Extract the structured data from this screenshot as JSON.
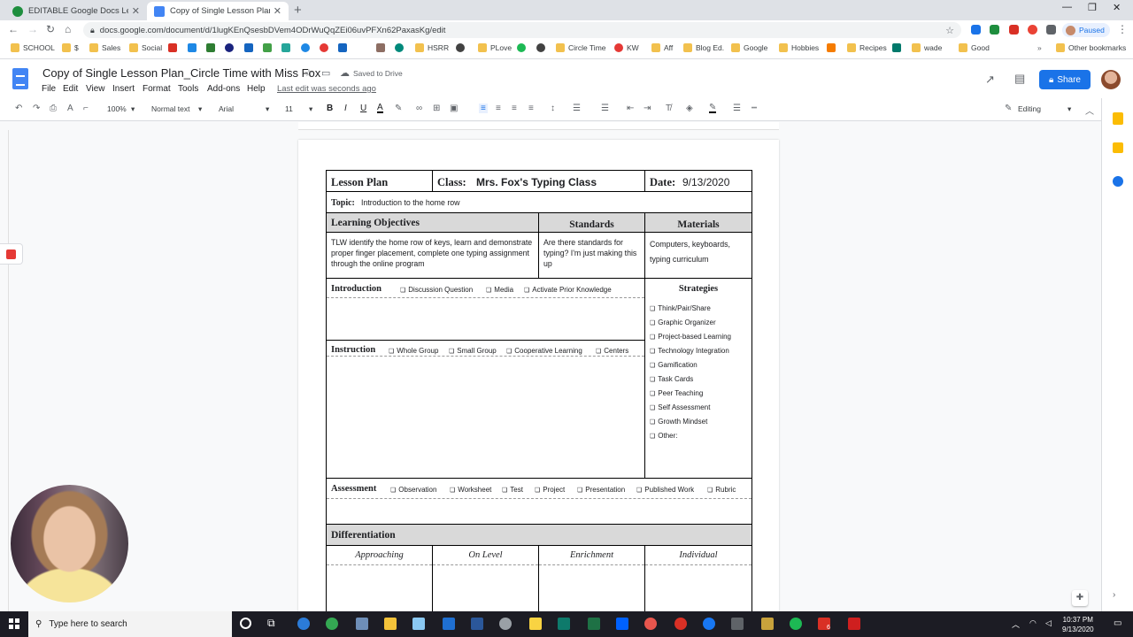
{
  "browser": {
    "tabs": [
      {
        "title": "EDITABLE Google Docs Lesson Pl",
        "icon": "edge-icon",
        "color": "#1e8e3e",
        "active": false
      },
      {
        "title": "Copy of Single Lesson Plan_Circle",
        "icon": "docs-icon",
        "color": "#4285f4",
        "active": true
      }
    ],
    "url": "docs.google.com/document/d/1lugKEnQsesbDVem4ODrWuQqZEi06uvPFXn62PaxasKg/edit",
    "profile_label": "Paused",
    "bookmarks": [
      "SCHOOL",
      "$",
      "Sales",
      "Social",
      "",
      "",
      "",
      "",
      "",
      "",
      "",
      "",
      "",
      "",
      "HSRR",
      "",
      "PLove",
      "",
      "Circle Time",
      "KW",
      "Aff",
      "Blog Ed.",
      "Google",
      "Hobbies",
      "",
      "Recipes",
      "",
      "wade",
      "Good"
    ],
    "other_bookmarks": "Other bookmarks"
  },
  "docs": {
    "title": "Copy of Single Lesson Plan_Circle Time with Miss Fox",
    "saved_status": "Saved to Drive",
    "menus": [
      "File",
      "Edit",
      "View",
      "Insert",
      "Format",
      "Tools",
      "Add-ons",
      "Help"
    ],
    "last_edit": "Last edit was seconds ago",
    "share_label": "Share",
    "zoom": "100%",
    "style": "Normal text",
    "font": "Arial",
    "font_size": "11",
    "mode": "Editing",
    "accent": "#1a73e8"
  },
  "lesson": {
    "lesson_plan_label": "Lesson Plan",
    "class_label": "Class:",
    "class_value": "Mrs. Fox's Typing Class",
    "date_label": "Date:",
    "date_value": "9/13/2020",
    "topic_label": "Topic:",
    "topic_value": "Introduction to the home row",
    "objectives_header": "Learning Objectives",
    "standards_header": "Standards",
    "materials_header": "Materials",
    "objectives_text": "TLW identify the home row of keys, learn and demonstrate proper finger placement, complete one typing assignment through the online program",
    "standards_text": "Are there standards for typing? I'm just making this up",
    "materials_text": "Computers, keyboards, typing curriculum",
    "introduction_label": "Introduction",
    "introduction_options": [
      "Discussion Question",
      "Media",
      "Activate Prior Knowledge"
    ],
    "instruction_label": "Instruction",
    "instruction_options": [
      "Whole Group",
      "Small Group",
      "Cooperative Learning",
      "Centers"
    ],
    "strategies_header": "Strategies",
    "strategies": [
      "Think/Pair/Share",
      "Graphic Organizer",
      "Project-based Learning",
      "Technology Integration",
      "Gamification",
      "Task Cards",
      "Peer Teaching",
      "Self Assessment",
      "Growth Mindset",
      "Other:"
    ],
    "assessment_label": "Assessment",
    "assessment_options": [
      "Observation",
      "Worksheet",
      "Test",
      "Project",
      "Presentation",
      "Published Work",
      "Rubric"
    ],
    "differentiation_header": "Differentiation",
    "differentiation_levels": [
      "Approaching",
      "On Level",
      "Enrichment",
      "Individual"
    ]
  },
  "taskbar": {
    "search_placeholder": "Type here to search",
    "time": "10:37 PM",
    "date": "9/13/2020",
    "notification_count": "6"
  }
}
